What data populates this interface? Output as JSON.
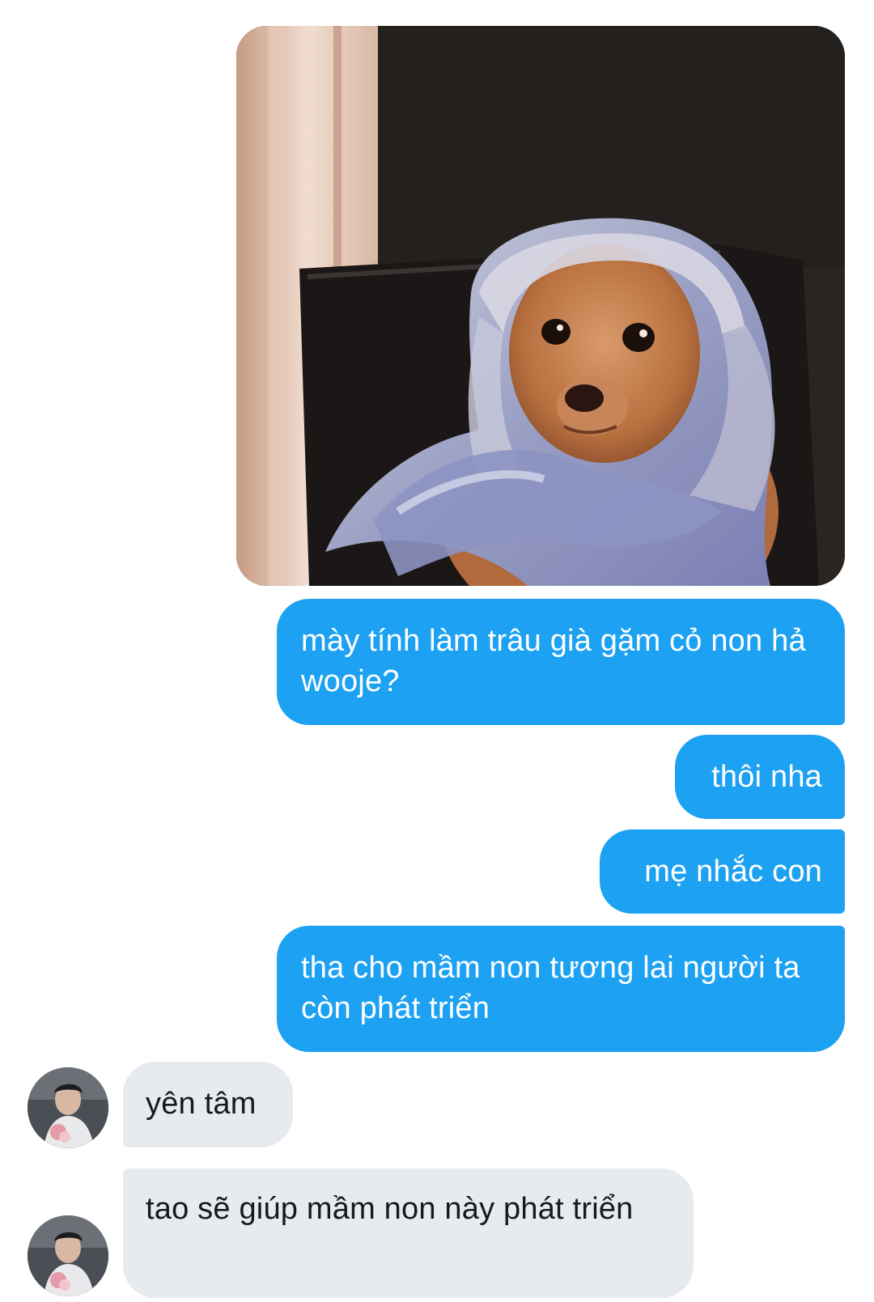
{
  "conversation": {
    "messages": [
      {
        "direction": "outgoing",
        "type": "image",
        "image_alt": "dog-in-headscarf-meme"
      },
      {
        "direction": "outgoing",
        "type": "text",
        "text": "mày tính làm trâu già gặm cỏ non hả wooje?"
      },
      {
        "direction": "outgoing",
        "type": "text",
        "text": "thôi nha"
      },
      {
        "direction": "outgoing",
        "type": "text",
        "text": "mẹ nhắc con"
      },
      {
        "direction": "outgoing",
        "type": "text",
        "text": "tha cho mầm non tương lai người ta còn phát triển"
      },
      {
        "direction": "incoming",
        "type": "text",
        "text": "yên tâm"
      },
      {
        "direction": "incoming",
        "type": "text",
        "text": "tao sẽ giúp mầm non này phát triển"
      }
    ]
  },
  "colors": {
    "outgoing_bubble": "#1da1f2",
    "incoming_bubble": "#e7ebef",
    "background": "#ffffff"
  },
  "icons": {
    "avatar": "contact-avatar-photo"
  }
}
